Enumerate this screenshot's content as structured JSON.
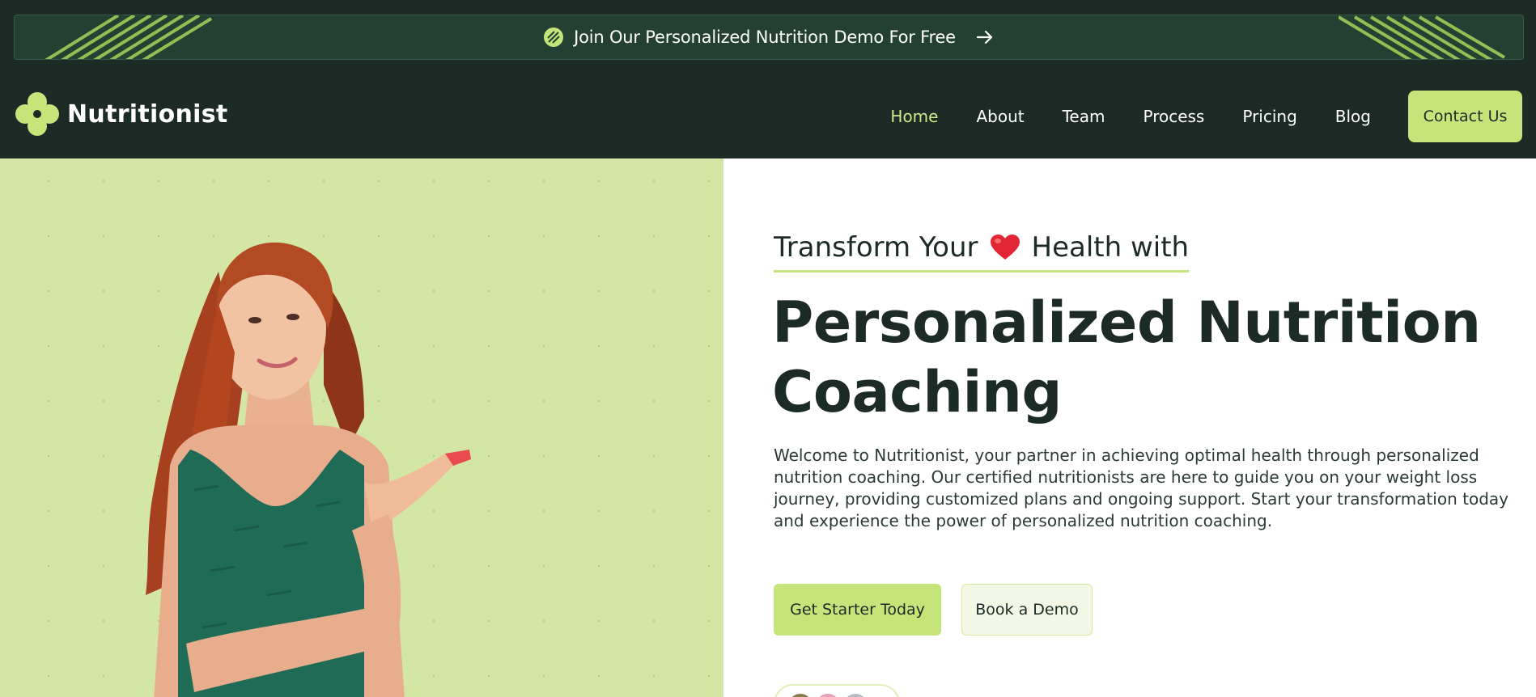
{
  "promo": {
    "text": "Join Our Personalized Nutrition Demo For Free",
    "leaf_icon": "leaf-icon",
    "arrow_icon": "arrow-right-icon"
  },
  "header": {
    "logo_text": "Nutritionist",
    "logo_icon": "clover-icon",
    "nav": [
      {
        "label": "Home",
        "active": true
      },
      {
        "label": "About"
      },
      {
        "label": "Team"
      },
      {
        "label": "Process"
      },
      {
        "label": "Pricing"
      },
      {
        "label": "Blog"
      }
    ],
    "contact_label": "Contact Us"
  },
  "hero": {
    "tagline_before": "Transform Your",
    "tagline_icon": "heart-icon",
    "tagline_after": "Health with",
    "headline": "Personalized Nutrition Coaching",
    "intro": "Welcome to Nutritionist, your partner in achieving optimal health through personalized nutrition coaching. Our certified nutritionists are here to guide you on your weight loss journey, providing customized plans and ongoing support. Start your transformation today and experience the power of personalized nutrition coaching.",
    "primary_button": "Get Starter Today",
    "secondary_button": "Book a Demo"
  },
  "colors": {
    "dark_green": "#1c2b26",
    "lime_accent": "#c5e57a",
    "hero_left_bg": "#d3e6a4"
  }
}
